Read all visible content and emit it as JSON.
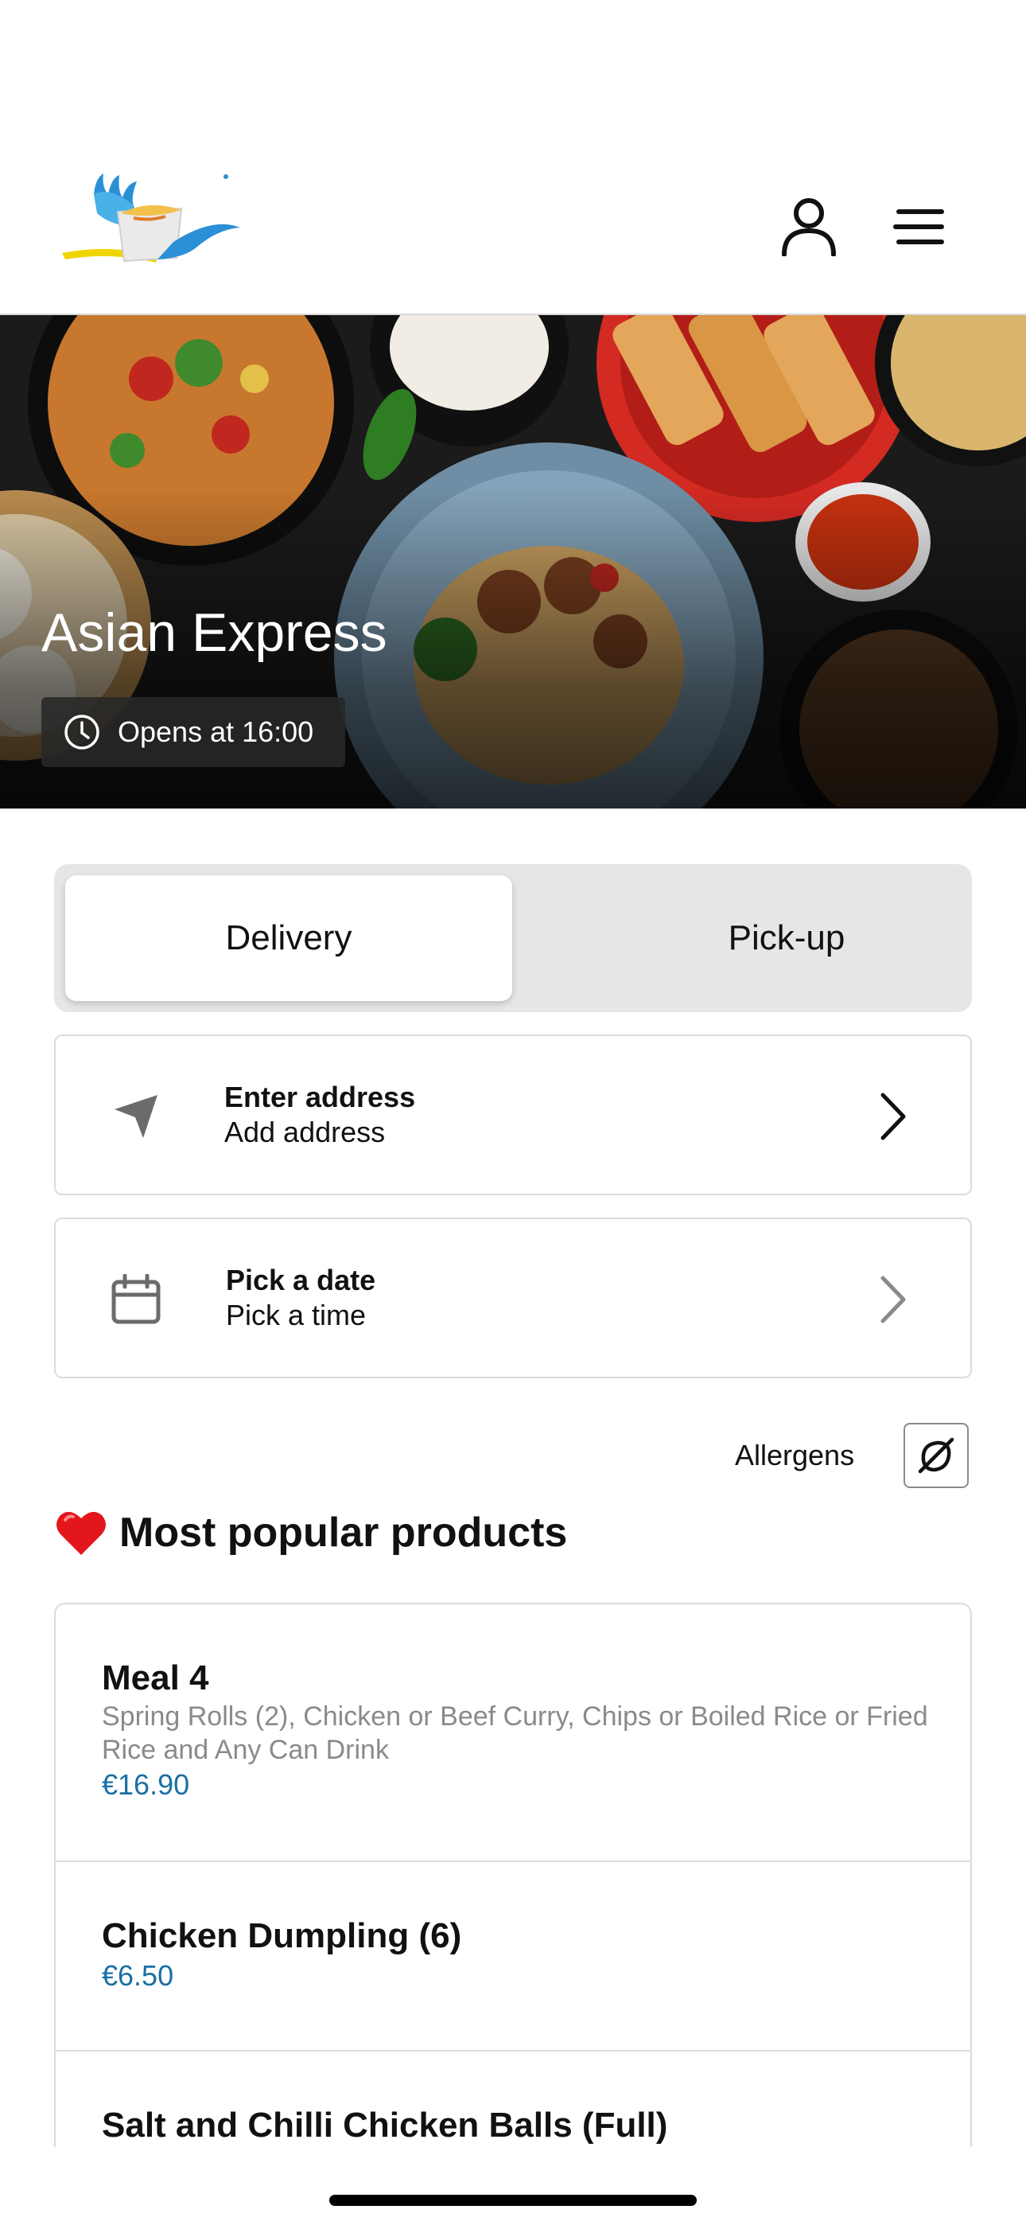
{
  "header": {
    "logo_icon": "restaurant-logo-bird-bowl",
    "account_icon": "user-icon",
    "menu_icon": "menu-icon"
  },
  "hero": {
    "title": "Asian Express",
    "hours_icon": "clock-icon",
    "hours_text": "Opens at 16:00"
  },
  "order_mode": {
    "options": [
      "Delivery",
      "Pick-up"
    ],
    "selected": "Delivery"
  },
  "address": {
    "icon": "location-arrow-icon",
    "title": "Enter address",
    "subtitle": "Add address"
  },
  "schedule": {
    "icon": "calendar-icon",
    "title": "Pick a date",
    "subtitle": "Pick a time"
  },
  "allergens": {
    "label": "Allergens",
    "icon": "allergen-filter-icon"
  },
  "popular": {
    "icon": "heart-icon",
    "title": "Most popular products",
    "products": [
      {
        "name": "Meal 4",
        "description": "Spring Rolls (2), Chicken or Beef Curry, Chips or Boiled Rice or Fried Rice and Any Can Drink",
        "price": "€16.90"
      },
      {
        "name": "Chicken Dumpling (6)",
        "price": "€6.50"
      },
      {
        "name": "Salt and Chilli Chicken Balls (Full)"
      }
    ]
  },
  "colors": {
    "accent_price": "#1a6fa3",
    "toggle_bg": "#e6e6e6",
    "border": "#dcdcdc"
  }
}
